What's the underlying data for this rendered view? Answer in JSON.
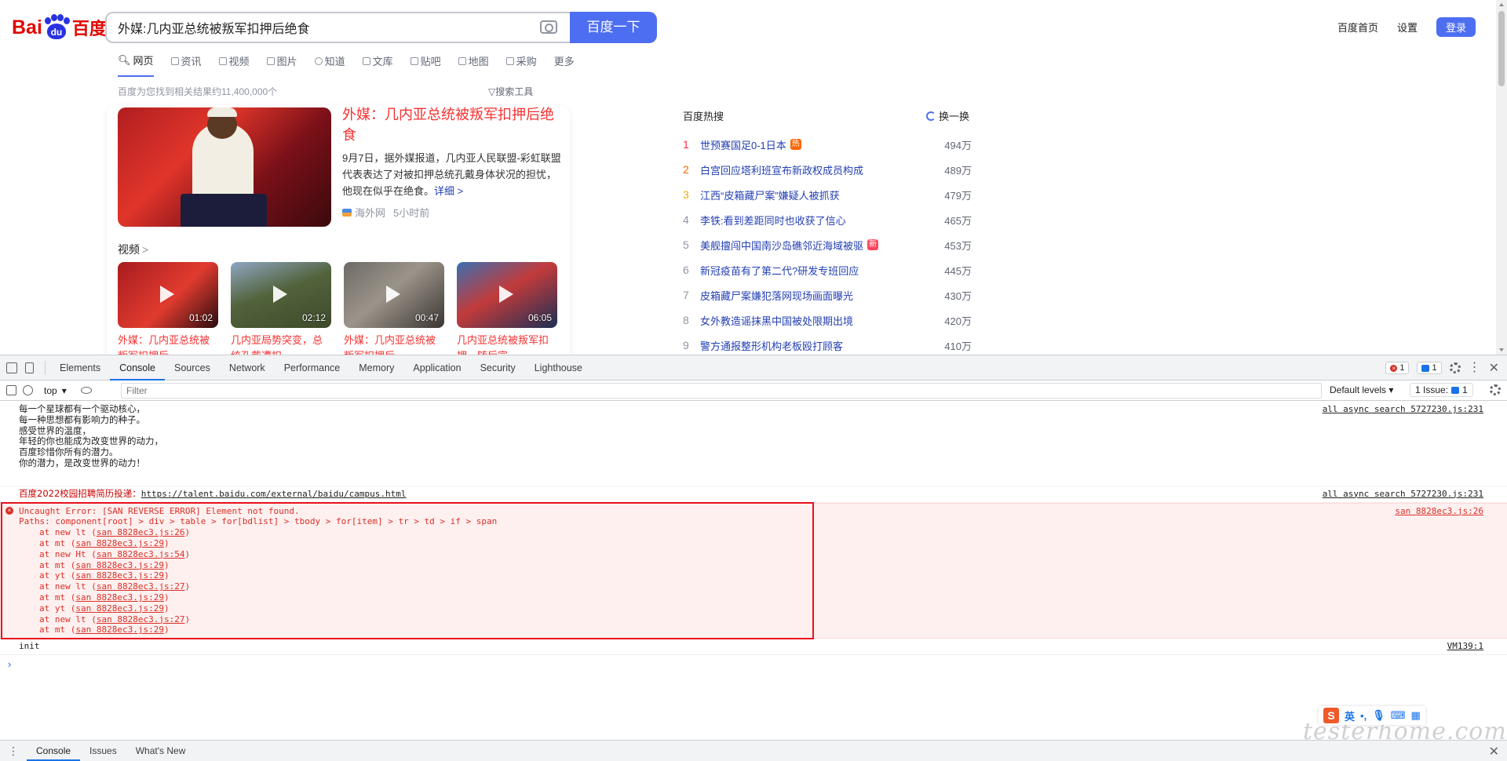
{
  "baidu": {
    "logo_bai": "Bai",
    "logo_du": "du",
    "logo_zh": "百度",
    "search_value": "外媒:几内亚总统被叛军扣押后绝食",
    "search_button": "百度一下",
    "top_links": [
      "百度首页",
      "设置"
    ],
    "login": "登录",
    "tabs": [
      "网页",
      "资讯",
      "视频",
      "图片",
      "知道",
      "文库",
      "贴吧",
      "地图",
      "采购",
      "更多"
    ],
    "result_count": "百度为您找到相关结果约11,400,000个",
    "search_tools": "搜索工具",
    "news": {
      "title": "外媒：几内亚总统被叛军扣押后绝食",
      "desc": "9月7日，据外媒报道，几内亚人民联盟-彩虹联盟代表表达了对被扣押总统孔戴身体状况的担忧，他现在似乎在绝食。",
      "more": "详细 >",
      "source": "海外网",
      "time": "5小时前"
    },
    "video_label": "视频",
    "video_chevron": ">",
    "videos": [
      {
        "duration": "01:02",
        "title": "外媒：几内亚总统被叛军扣押后..."
      },
      {
        "duration": "02:12",
        "title": "几内亚局势突变，总统孔戴遭扣..."
      },
      {
        "duration": "00:47",
        "title": "外媒：几内亚总统被叛军扣押后..."
      },
      {
        "duration": "06:05",
        "title": "几内亚总统被叛军扣押，随后宣..."
      }
    ],
    "hot_title": "百度热搜",
    "hot_refresh": "换一换",
    "hot": [
      {
        "rank": "1",
        "text": "世预赛国足0-1日本",
        "badge": "热",
        "count": "494万"
      },
      {
        "rank": "2",
        "text": "白宫回应塔利班宣布新政权成员构成",
        "badge": "",
        "count": "489万"
      },
      {
        "rank": "3",
        "text": "江西“皮箱藏尸案”嫌疑人被抓获",
        "badge": "",
        "count": "479万"
      },
      {
        "rank": "4",
        "text": "李铁:看到差距同时也收获了信心",
        "badge": "",
        "count": "465万"
      },
      {
        "rank": "5",
        "text": "美舰擅闯中国南沙岛礁邻近海域被驱",
        "badge": "新",
        "count": "453万"
      },
      {
        "rank": "6",
        "text": "新冠疫苗有了第二代?研发专班回应",
        "badge": "",
        "count": "445万"
      },
      {
        "rank": "7",
        "text": "皮箱藏尸案嫌犯落网现场画面曝光",
        "badge": "",
        "count": "430万"
      },
      {
        "rank": "8",
        "text": "女外教造谣抹黑中国被处限期出境",
        "badge": "",
        "count": "420万"
      },
      {
        "rank": "9",
        "text": "警方通报整形机构老板殴打顾客",
        "badge": "",
        "count": "410万"
      }
    ],
    "colors": {
      "brand_blue": "#4e6ef2",
      "brand_red": "#e10601",
      "hot_badge": "#ff6600",
      "new_badge": "#ff455b"
    }
  },
  "devtools": {
    "tabs": [
      "Elements",
      "Console",
      "Sources",
      "Network",
      "Performance",
      "Memory",
      "Application",
      "Security",
      "Lighthouse"
    ],
    "error_count": "1",
    "message_count": "1",
    "context": "top",
    "filter_placeholder": "Filter",
    "levels": "Default levels",
    "issues_label": "1 Issue:",
    "issues_count": "1",
    "logs": {
      "poem_lines": [
        "每一个星球都有一个驱动核心，",
        "每一种思想都有影响力的种子。",
        "感受世界的温度，",
        "年轻的你也能成为改变世界的动力，",
        "百度珍惜你所有的潜力。",
        "你的潜力，是改变世界的动力！"
      ],
      "poem_source": "all async search 5727230.js:231",
      "recruit_text": "百度2022校园招聘简历投递：",
      "recruit_url": "https://talent.baidu.com/external/baidu/campus.html",
      "recruit_source": "all async search 5727230.js:231",
      "error_head": "Uncaught Error: [SAN REVERSE ERROR] Element not found.",
      "error_paths": "Paths: component[root] > div > table > for[bdlist] > tbody > for[item] > tr > td > if > span",
      "error_source": "san 8828ec3.js:26",
      "frames": [
        {
          "fn": "at new lt",
          "loc": "san 8828ec3.js:26"
        },
        {
          "fn": "at mt",
          "loc": "san 8828ec3.js:29"
        },
        {
          "fn": "at new Ht",
          "loc": "san 8828ec3.js:54"
        },
        {
          "fn": "at mt",
          "loc": "san 8828ec3.js:29"
        },
        {
          "fn": "at yt",
          "loc": "san 8828ec3.js:29"
        },
        {
          "fn": "at new lt",
          "loc": "san 8828ec3.js:27"
        },
        {
          "fn": "at mt",
          "loc": "san 8828ec3.js:29"
        },
        {
          "fn": "at yt",
          "loc": "san 8828ec3.js:29"
        },
        {
          "fn": "at new lt",
          "loc": "san 8828ec3.js:27"
        },
        {
          "fn": "at mt",
          "loc": "san 8828ec3.js:29"
        }
      ],
      "init_text": "init",
      "init_source": "VM139:1"
    },
    "prompt": "›",
    "drawer_tabs": [
      "Console",
      "Issues",
      "What's New"
    ]
  },
  "ime": {
    "logo": "S",
    "lang": "英"
  },
  "watermark": "testerhome.com"
}
